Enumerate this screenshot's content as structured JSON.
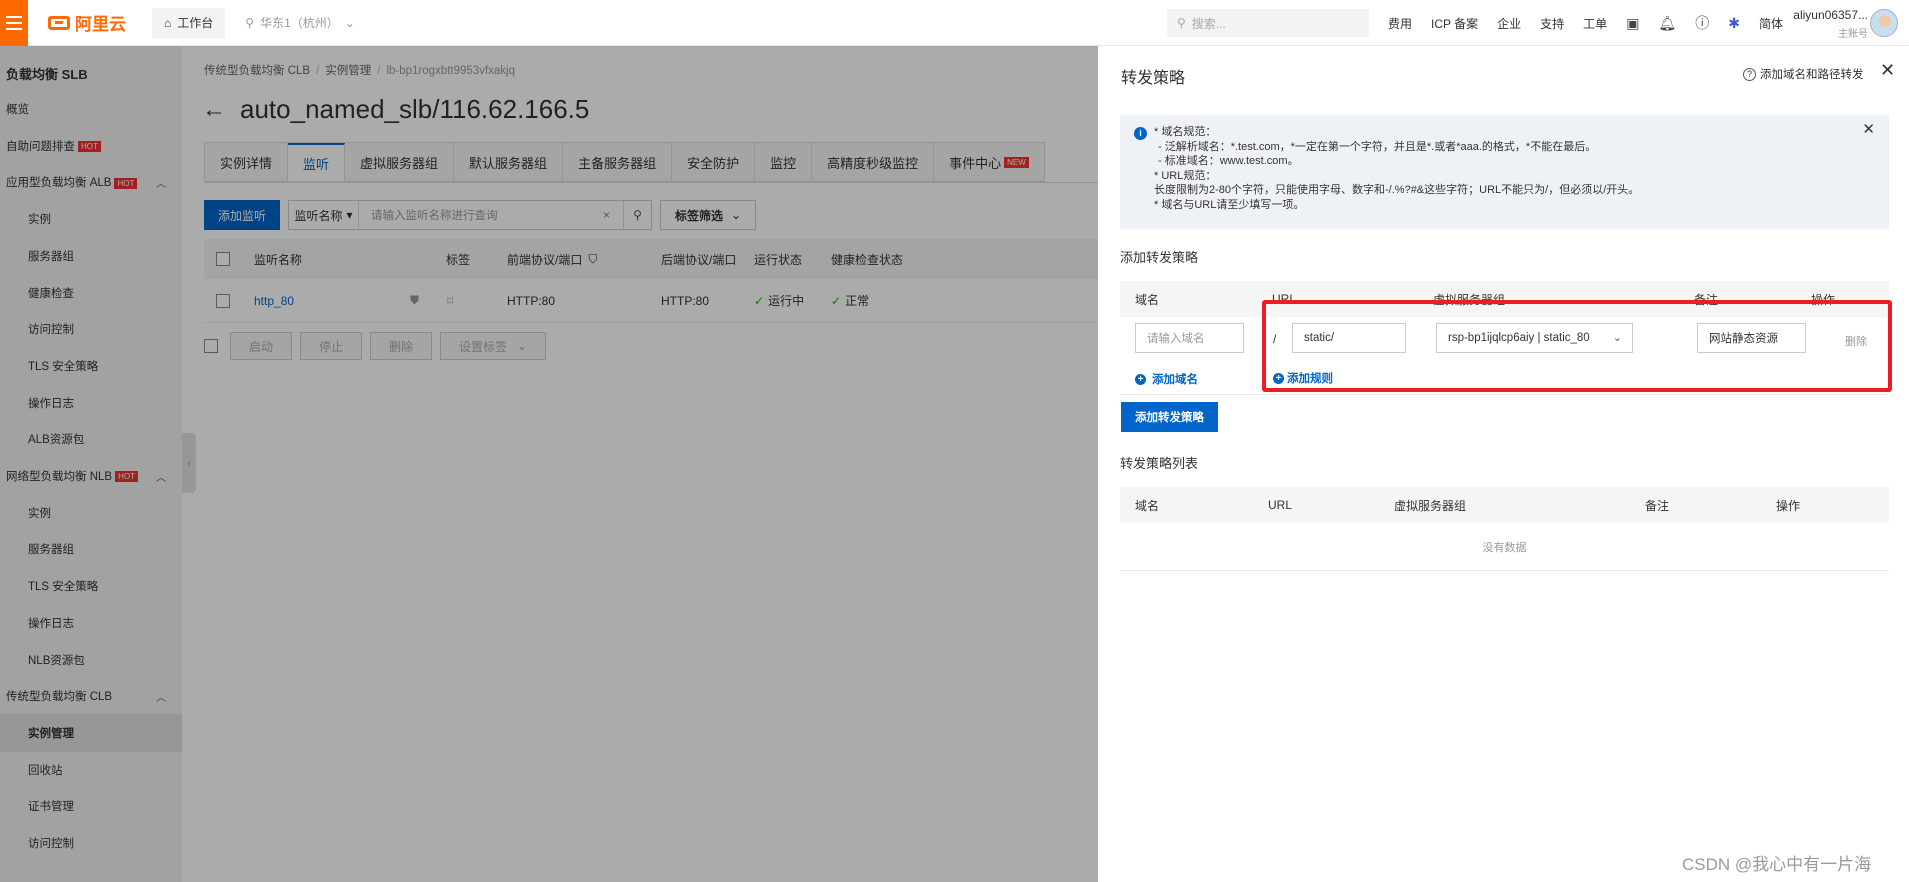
{
  "topbar": {
    "logo_text": "阿里云",
    "workbench": "工作台",
    "region": "华东1（杭州）",
    "search_placeholder": "搜索...",
    "nav": [
      "费用",
      "ICP 备案",
      "企业",
      "支持",
      "工单"
    ],
    "lang": "简体",
    "user_name": "aliyun06357...",
    "user_role": "主账号"
  },
  "sidebar": {
    "title": "负载均衡 SLB",
    "items": [
      {
        "label": "概览",
        "kind": "group"
      },
      {
        "label": "自助问题排查",
        "kind": "group",
        "badge": "HOT"
      },
      {
        "label": "应用型负载均衡 ALB",
        "kind": "group",
        "badge": "HOT",
        "expanded": true
      },
      {
        "label": "实例",
        "kind": "sub"
      },
      {
        "label": "服务器组",
        "kind": "sub"
      },
      {
        "label": "健康检查",
        "kind": "sub"
      },
      {
        "label": "访问控制",
        "kind": "sub"
      },
      {
        "label": "TLS 安全策略",
        "kind": "sub"
      },
      {
        "label": "操作日志",
        "kind": "sub"
      },
      {
        "label": "ALB资源包",
        "kind": "sub"
      },
      {
        "label": "网络型负载均衡 NLB",
        "kind": "group",
        "badge": "HOT",
        "expanded": true
      },
      {
        "label": "实例",
        "kind": "sub"
      },
      {
        "label": "服务器组",
        "kind": "sub"
      },
      {
        "label": "TLS 安全策略",
        "kind": "sub"
      },
      {
        "label": "操作日志",
        "kind": "sub"
      },
      {
        "label": "NLB资源包",
        "kind": "sub"
      },
      {
        "label": "传统型负载均衡 CLB",
        "kind": "group",
        "expanded": true
      },
      {
        "label": "实例管理",
        "kind": "sub",
        "active": true
      },
      {
        "label": "回收站",
        "kind": "sub"
      },
      {
        "label": "证书管理",
        "kind": "sub"
      },
      {
        "label": "访问控制",
        "kind": "sub"
      }
    ]
  },
  "main": {
    "breadcrumb": [
      "传统型负载均衡 CLB",
      "实例管理",
      "lb-bp1rogxbtt9953vfxakjq"
    ],
    "title": "auto_named_slb/116.62.166.5",
    "tabs": [
      "实例详情",
      "监听",
      "虚拟服务器组",
      "默认服务器组",
      "主备服务器组",
      "安全防护",
      "监控",
      "高精度秒级监控",
      "事件中心"
    ],
    "active_tab": "监听",
    "tab_new_badge": "NEW",
    "add_listener": "添加监听",
    "filter_select": "监听名称",
    "filter_placeholder": "请输入监听名称进行查询",
    "tag_filter": "标签筛选",
    "columns": [
      "监听名称",
      "标签",
      "前端协议/端口",
      "后端协议/端口",
      "运行状态",
      "健康检查状态"
    ],
    "rows": [
      {
        "name": "http_80",
        "frontend": "HTTP:80",
        "backend": "HTTP:80",
        "status": "运行中",
        "health": "正常"
      }
    ],
    "bulk_actions": [
      "启动",
      "停止",
      "删除",
      "设置标签"
    ]
  },
  "drawer": {
    "title": "转发策略",
    "help_link": "添加域名和路径转发",
    "notice_lines": [
      "* 域名规范：",
      "- 泛解析域名：*.test.com，*一定在第一个字符，并且是*.或者*aaa.的格式，*不能在最后。",
      "- 标准域名：www.test.com。",
      "* URL规范：",
      "长度限制为2-80个字符，只能使用字母、数字和-/.%?#&这些字符；URL不能只为/，但必须以/开头。",
      "* 域名与URL请至少填写一项。"
    ],
    "add_section_title": "添加转发策略",
    "rule_columns": [
      "域名",
      "URL",
      "虚拟服务器组",
      "备注",
      "操作"
    ],
    "domain_placeholder": "请输入域名",
    "url_prefix": "/",
    "url_value": "static/",
    "server_group": "rsp-bp1ijqlcp6aiy | static_80",
    "remark_value": "网站静态资源",
    "delete_label": "删除",
    "add_domain": "添加域名",
    "add_rule": "添加规则",
    "add_policy_button": "添加转发策略",
    "list_section_title": "转发策略列表",
    "list_columns": [
      "域名",
      "URL",
      "虚拟服务器组",
      "备注",
      "操作"
    ],
    "empty_text": "没有数据"
  },
  "watermark": "CSDN @我心中有一片海",
  "colors": {
    "brand": "#ff6a00",
    "primary": "#0064c8",
    "highlight": "#ee1c25",
    "hot": "#f23030"
  }
}
